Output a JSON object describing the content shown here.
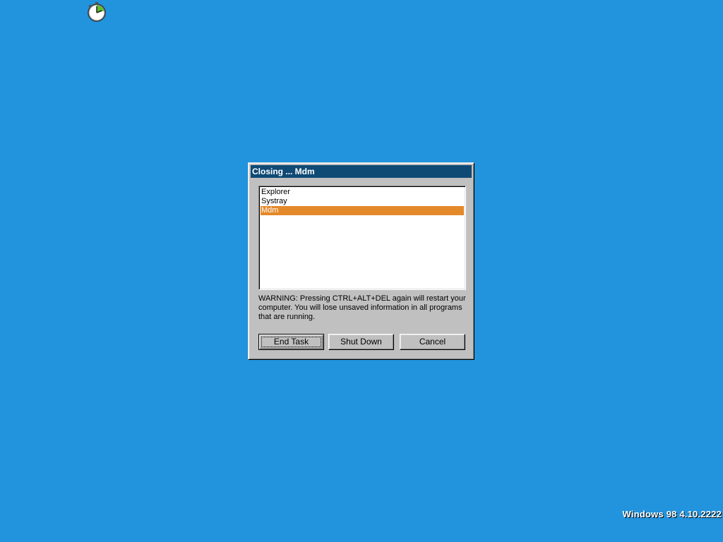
{
  "desktop": {
    "background": "#2293dd",
    "icon": "clock-icon",
    "build_string": "Windows 98 4.10.2222"
  },
  "dialog": {
    "title": "Closing ... Mdm",
    "tasks": [
      {
        "label": "Explorer",
        "selected": false
      },
      {
        "label": "Systray",
        "selected": false
      },
      {
        "label": "Mdm",
        "selected": true
      }
    ],
    "warning": "WARNING: Pressing CTRL+ALT+DEL again will restart your computer. You will lose unsaved information in all programs that are running.",
    "buttons": {
      "end_task": "End Task",
      "shut_down": "Shut Down",
      "cancel": "Cancel"
    },
    "colors": {
      "titlebar": "#0f4a75",
      "selection": "#e4892a",
      "face": "#c0c0c0"
    }
  }
}
